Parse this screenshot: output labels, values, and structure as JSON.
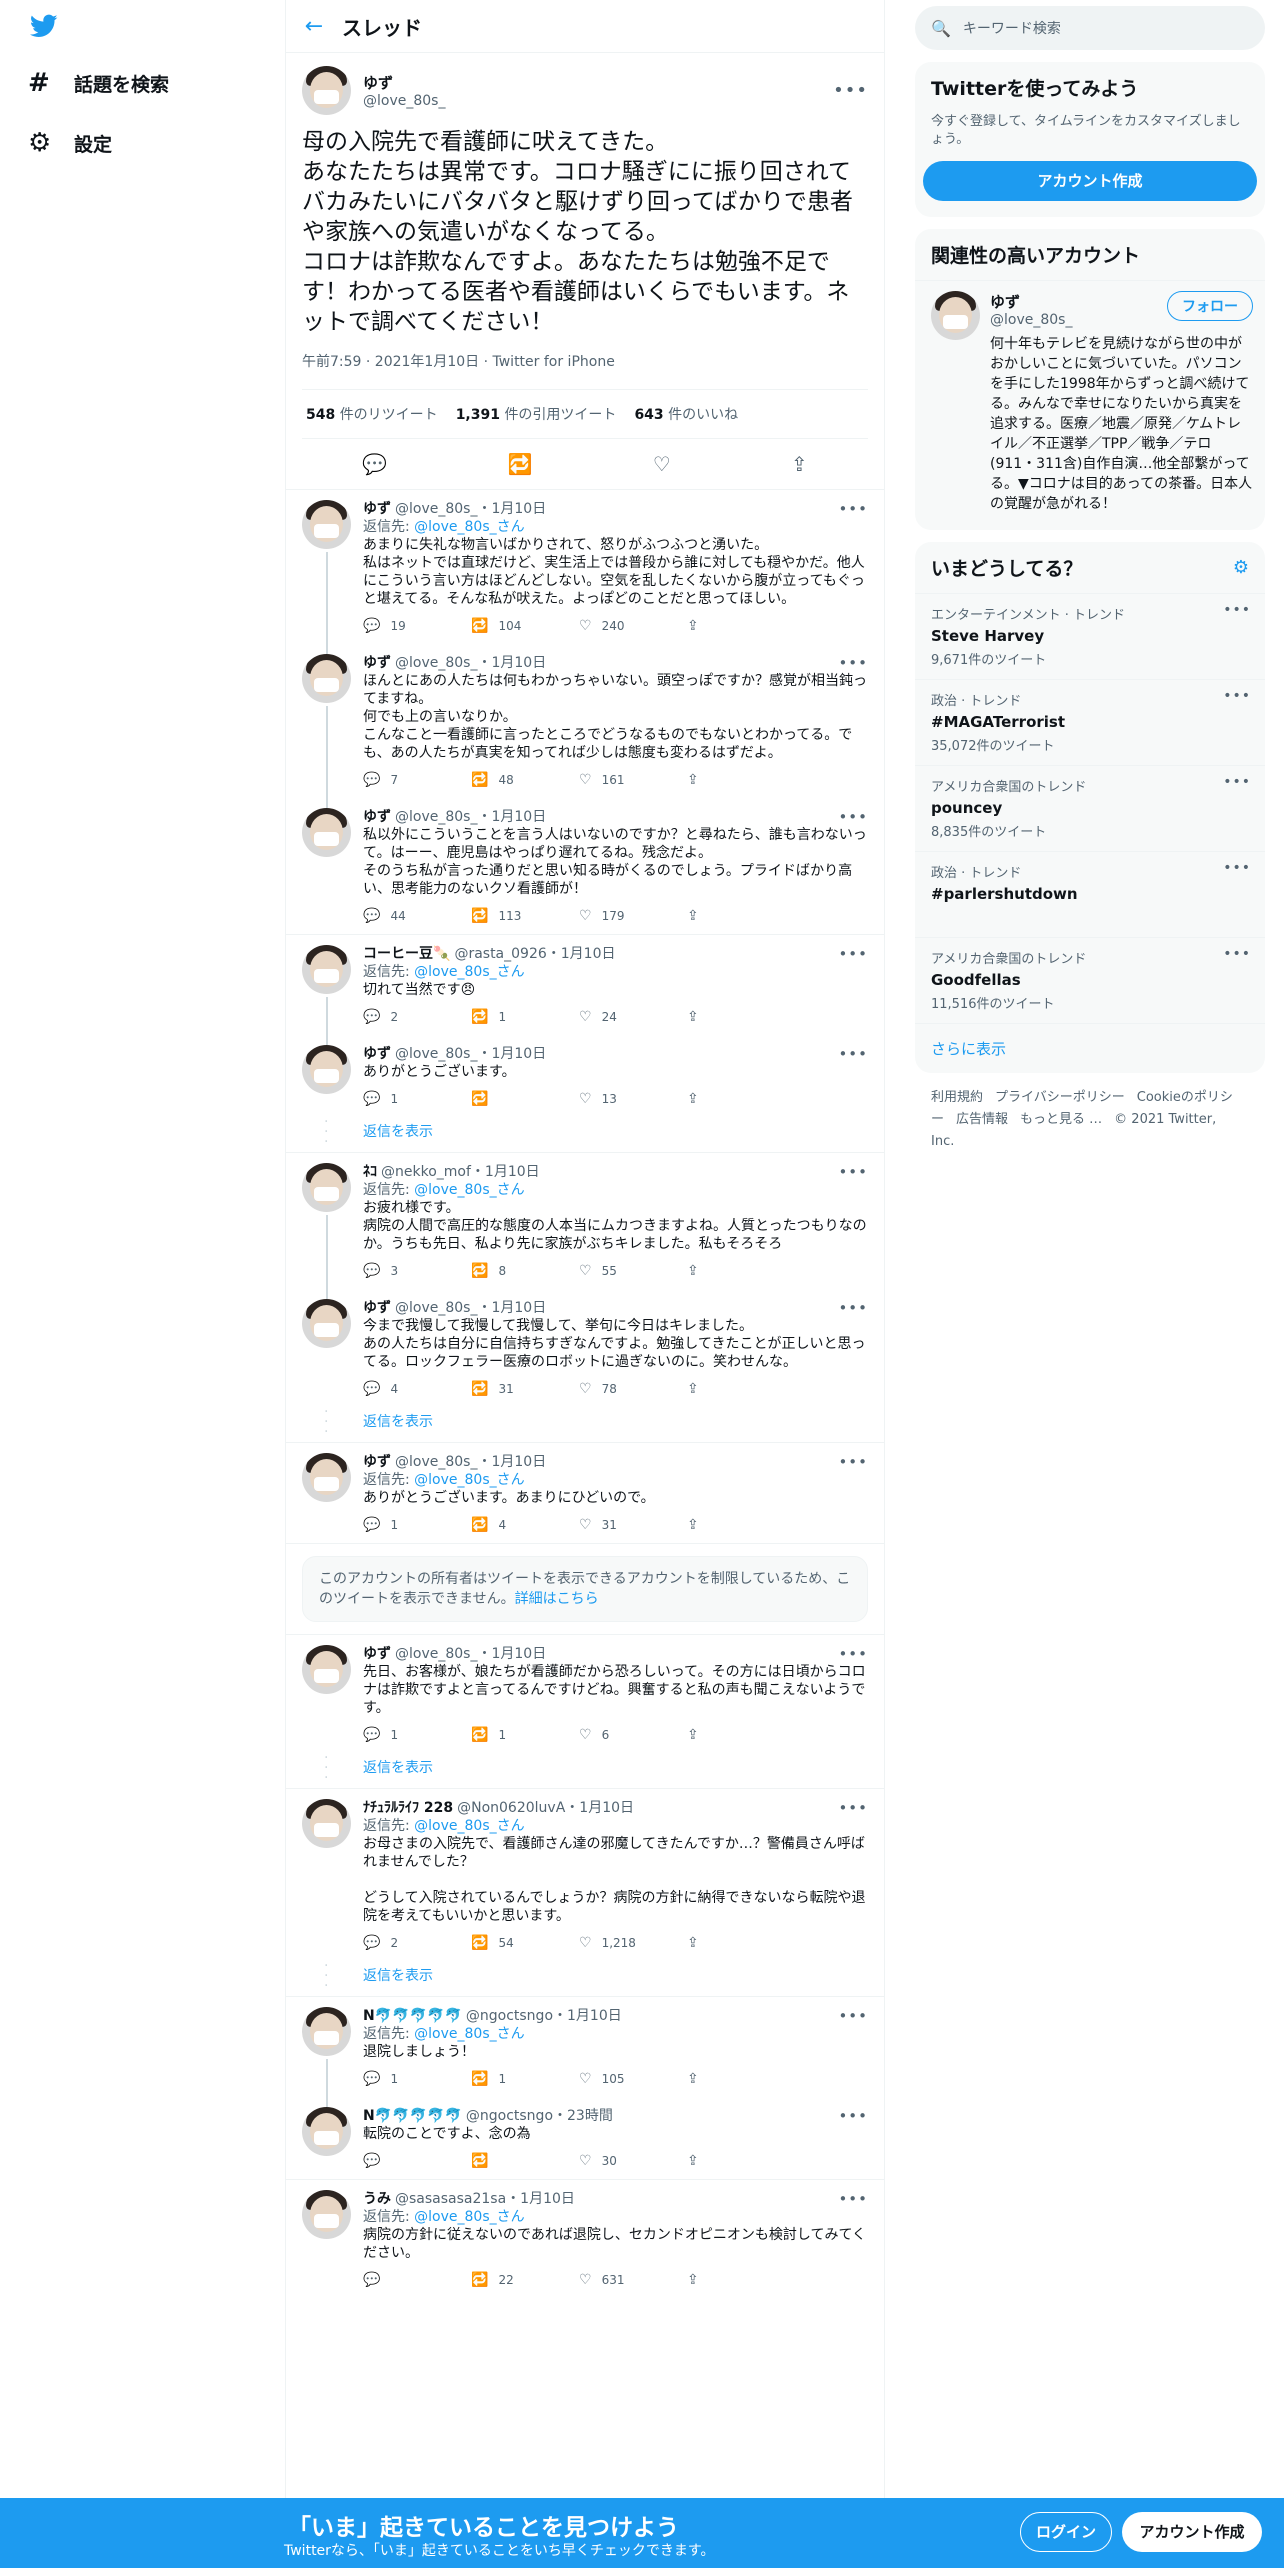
{
  "nav": {
    "logo": "twitter-bird-icon",
    "items": [
      {
        "icon": "hashtag-icon",
        "label": "話題を検索"
      },
      {
        "icon": "gear-icon",
        "label": "設定"
      }
    ]
  },
  "header": {
    "title": "スレッド"
  },
  "main_tweet": {
    "name": "ゆず",
    "handle": "@love_80s_",
    "body": "母の入院先で看護師に吠えてきた。\nあなたたちは異常です。コロナ騒ぎにに振り回されてバカみたいにバタバタと駆けずり回ってばかりで患者や家族への気遣いがなくなってる。\nコロナは詐欺なんですよ。あなたたちは勉強不足です！わかってる医者や看護師はいくらでもいます。ネットで調べてください！",
    "meta": "午前7:59 · 2021年1月10日 · Twitter for iPhone",
    "retweets_count": "548",
    "retweets_label": "件のリツイート",
    "quotes_count": "1,391",
    "quotes_label": "件の引用ツイート",
    "likes_count": "643",
    "likes_label": "件のいいね"
  },
  "replies": [
    {
      "name": "ゆず",
      "handle": "@love_80s_",
      "date": "・1月10日",
      "reply_to": "@love_80s_さん",
      "text": "あまりに失礼な物言いばかりされて、怒りがふつふつと湧いた。\n私はネットでは直球だけど、実生活上では普段から誰に対しても穏やかだ。他人にこういう言い方はほどんどしない。空気を乱したくないから腹が立ってもぐっと堪えてる。そんな私が吠えた。よっぽどのことだと思ってほしい。",
      "replies": "19",
      "retweets": "104",
      "likes": "240"
    },
    {
      "name": "ゆず",
      "handle": "@love_80s_",
      "date": "・1月10日",
      "reply_to": "",
      "text": "ほんとにあの人たちは何もわかっちゃいない。頭空っぽですか？感覚が相当鈍ってますね。\n何でも上の言いなりか。\nこんなこと一看護師に言ったところでどうなるものでもないとわかってる。でも、あの人たちが真実を知ってれば少しは態度も変わるはずだよ。",
      "replies": "7",
      "retweets": "48",
      "likes": "161"
    },
    {
      "name": "ゆず",
      "handle": "@love_80s_",
      "date": "・1月10日",
      "reply_to": "",
      "text": "私以外にこういうことを言う人はいないのですか？と尋ねたら、誰も言わないって。はーー、鹿児島はやっぱり遅れてるね。残念だよ。\nそのうち私が言った通りだと思い知る時がくるのでしょう。プライドばかり高い、思考能力のないクソ看護師が！",
      "replies": "44",
      "retweets": "113",
      "likes": "179"
    },
    {
      "name": "コーヒー豆🍡",
      "handle": "@rasta_0926",
      "date": "・1月10日",
      "reply_to": "@love_80s_さん",
      "text": "切れて当然です😠",
      "replies": "2",
      "retweets": "1",
      "likes": "24"
    },
    {
      "name": "ゆず",
      "handle": "@love_80s_",
      "date": "・1月10日",
      "reply_to": "",
      "text": "ありがとうございます。",
      "replies": "1",
      "retweets": "",
      "likes": "13"
    },
    {
      "name": "ﾈｺ",
      "handle": "@nekko_mof",
      "date": "・1月10日",
      "reply_to": "@love_80s_さん",
      "text": "お疲れ様です。\n病院の人間で高圧的な態度の人本当にムカつきますよね。人質とったつもりなのか。うちも先日、私より先に家族がぶちキレました。私もそろそろ",
      "replies": "3",
      "retweets": "8",
      "likes": "55"
    },
    {
      "name": "ゆず",
      "handle": "@love_80s_",
      "date": "・1月10日",
      "reply_to": "",
      "text": "今まで我慢して我慢して我慢して、挙句に今日はキレました。\nあの人たちは自分に自信持ちすぎなんですよ。勉強してきたことが正しいと思ってる。ロックフェラー医療のロボットに過ぎないのに。笑わせんな。",
      "replies": "4",
      "retweets": "31",
      "likes": "78"
    },
    {
      "name": "ゆず",
      "handle": "@love_80s_",
      "date": "・1月10日",
      "reply_to": "@love_80s_さん",
      "text": "ありがとうございます。あまりにひどいので。",
      "replies": "1",
      "retweets": "4",
      "likes": "31"
    },
    {
      "name": "ゆず",
      "handle": "@love_80s_",
      "date": "・1月10日",
      "reply_to": "",
      "text": "先日、お客様が、娘たちが看護師だから恐ろしいって。その方には日頃からコロナは詐欺ですよと言ってるんですけどね。興奮すると私の声も聞こえないようです。",
      "replies": "1",
      "retweets": "1",
      "likes": "6"
    },
    {
      "name": "ﾅﾁｭﾗﾙﾗｲﾌ 228",
      "handle": "@Non0620luvA",
      "date": "・1月10日",
      "reply_to": "@love_80s_さん",
      "text": "お母さまの入院先で、看護師さん達の邪魔してきたんですか…？警備員さん呼ばれませんでした？\n\nどうして入院されているんでしょうか？病院の方針に納得できないなら転院や退院を考えてもいいかと思います。",
      "replies": "2",
      "retweets": "54",
      "likes": "1,218"
    },
    {
      "name": "N🐬🐬🐬🐬🐬",
      "handle": "@ngoctsngo",
      "date": "・1月10日",
      "reply_to": "@love_80s_さん",
      "text": "退院しましょう！",
      "replies": "1",
      "retweets": "1",
      "likes": "105"
    },
    {
      "name": "N🐬🐬🐬🐬🐬",
      "handle": "@ngoctsngo",
      "date": "・23時間",
      "reply_to": "",
      "text": "転院のことですよ、念の為",
      "replies": "",
      "retweets": "",
      "likes": "30"
    },
    {
      "name": "うみ",
      "handle": "@sasasasa21sa",
      "date": "・1月10日",
      "reply_to": "@love_80s_さん",
      "text": "病院の方針に従えないのであれば退院し、セカンドオピニオンも検討してみてください。",
      "replies": "",
      "retweets": "22",
      "likes": "631"
    }
  ],
  "reply_prefix": "返信先:",
  "show_replies_label": "返信を表示",
  "restricted_notice": "このアカウントの所有者はツイートを表示できるアカウントを制限しているため、このツイートを表示できません。",
  "restricted_link": "詳細はこちら",
  "sidebar": {
    "search_placeholder": "キーワード検索",
    "signup_title": "Twitterを使ってみよう",
    "signup_desc": "今すぐ登録して、タイムラインをカスタマイズしましょう。",
    "signup_button": "アカウント作成",
    "related_title": "関連性の高いアカウント",
    "related": {
      "name": "ゆず",
      "handle": "@love_80s_",
      "follow": "フォロー",
      "bio": "何十年もテレビを見続けながら世の中がおかしいことに気づいていた。パソコンを手にした1998年からずっと調べ続けてる。みんなで幸せになりたいから真実を追求する。医療／地震／原発／ケムトレイル／不正選挙／TPP／戦争／テロ(911・311含)自作自演…他全部繋がってる。▼コロナは目的あっての茶番。日本人の覚醒が急がれる！"
    },
    "trends_title": "いまどうしてる？",
    "trends": [
      {
        "category": "エンターテインメント · トレンド",
        "name": "Steve Harvey",
        "count": "9,671件のツイート"
      },
      {
        "category": "政治 · トレンド",
        "name": "#MAGATerrorist",
        "count": "35,072件のツイート"
      },
      {
        "category": "アメリカ合衆国のトレンド",
        "name": "pouncey",
        "count": "8,835件のツイート"
      },
      {
        "category": "政治 · トレンド",
        "name": "#parlershutdown",
        "count": ""
      },
      {
        "category": "アメリカ合衆国のトレンド",
        "name": "Goodfellas",
        "count": "11,516件のツイート"
      }
    ],
    "show_more": "さらに表示",
    "footer": [
      "利用規約",
      "プライバシーポリシー",
      "Cookieのポリシー",
      "広告情報",
      "もっと見る …",
      "© 2021 Twitter, Inc."
    ]
  },
  "bottom_banner": {
    "title": "「いま」起きていることを見つけよう",
    "subtitle": "Twitterなら、「いま」起きていることをいち早くチェックできます。",
    "login": "ログイン",
    "signup": "アカウント作成"
  },
  "colors": {
    "accent": "#1d9bf0",
    "text": "#0f1419",
    "secondary": "#536471"
  }
}
